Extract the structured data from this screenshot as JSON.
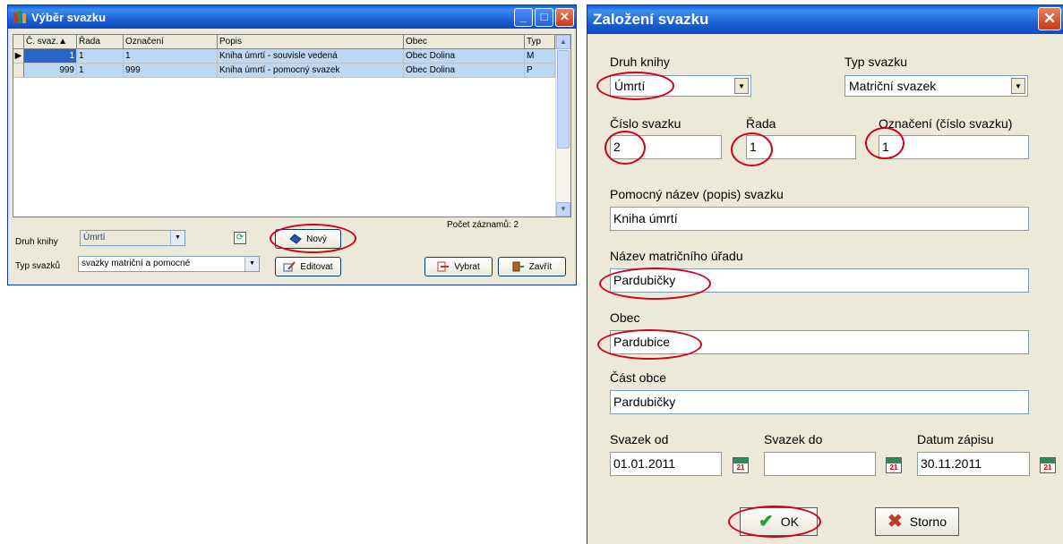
{
  "left_window": {
    "title": "Výběr svazku",
    "columns": [
      "Č. svaz.",
      "Řada",
      "Označení",
      "Popis",
      "Obec",
      "Typ"
    ],
    "sort_indicator": "▲",
    "rows": [
      {
        "cislo": "1",
        "rada": "1",
        "oznaceni": "1",
        "popis": "Kniha úmrtí - souvisle vedená",
        "obec": "Obec Dolina",
        "typ": "M"
      },
      {
        "cislo": "999",
        "rada": "1",
        "oznaceni": "999",
        "popis": "Kniha úmrtí - pomocný svazek",
        "obec": "Obec Dolina",
        "typ": "P"
      }
    ],
    "druh_label": "Druh knihy",
    "druh_value": "Úmrtí",
    "typ_label": "Typ svazků",
    "typ_value": "svazky matriční a pomocné",
    "count_label": "Počet záznamů: 2",
    "buttons": {
      "novy": "Nový",
      "editovat": "Editovat",
      "vybrat": "Vybrat",
      "zavrit": "Zavřít"
    }
  },
  "dialog": {
    "title": "Založení svazku",
    "druh_label": "Druh knihy",
    "druh_value": "Úmrtí",
    "typ_label": "Typ svazku",
    "typ_value": "Matriční svazek",
    "cislo_label": "Číslo svazku",
    "cislo_value": "2",
    "rada_label": "Řada",
    "rada_value": "1",
    "oznaceni_label": "Označení (číslo svazku)",
    "oznaceni_value": "1",
    "pomocny_label": "Pomocný název (popis) svazku",
    "pomocny_value": "Kniha úmrtí",
    "nazev_label": "Název matričního úřadu",
    "nazev_value": "Pardubičky",
    "obec_label": "Obec",
    "obec_value": "Pardubice",
    "cast_label": "Část obce",
    "cast_value": "Pardubičky",
    "svazek_od_label": "Svazek od",
    "svazek_od_value": "01.01.2011",
    "svazek_do_label": "Svazek do",
    "svazek_do_value": "",
    "datum_label": "Datum zápisu",
    "datum_value": "30.11.2011",
    "calendar_day": "21",
    "ok_label": "OK",
    "storno_label": "Storno"
  },
  "colors": {
    "titlebar": "#1e63d5",
    "highlight": "#d0021b",
    "selection": "#bcd8f5"
  }
}
